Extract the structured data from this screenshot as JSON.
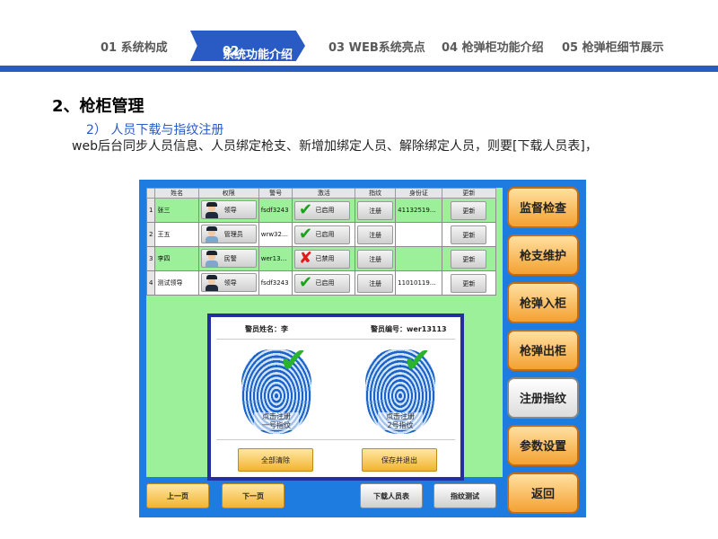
{
  "nav": {
    "items": [
      {
        "num": "01",
        "label": "系统构成"
      },
      {
        "num": "02",
        "label": "系统功能介绍"
      },
      {
        "num": "03",
        "label": "WEB系统亮点"
      },
      {
        "num": "04",
        "label": "枪弹柜功能介绍"
      },
      {
        "num": "05",
        "label": "枪弹柜细节展示"
      }
    ],
    "active_index": 1,
    "accent_color": "#2a5bc4"
  },
  "heading": "2、枪柜管理",
  "subheading": "2）  人员下载与指纹注册",
  "body_text": "web后台同步人员信息、人员绑定枪支、新增加绑定人员、解除绑定人员，则要[下载人员表]，",
  "app": {
    "columns": [
      "姓名",
      "权限",
      "警号",
      "激活",
      "指纹",
      "身份证",
      "更新"
    ],
    "rows": [
      {
        "idx": "1",
        "name": "张三",
        "role": "领导",
        "badge": "fsdf3243",
        "status": "已启用",
        "status_ok": true,
        "fp": "注册",
        "id": "41132519…",
        "update": "更新"
      },
      {
        "idx": "2",
        "name": "王五",
        "role": "管理员",
        "badge": "wrw32…",
        "status": "已启用",
        "status_ok": true,
        "fp": "注册",
        "id": "",
        "update": "更新"
      },
      {
        "idx": "3",
        "name": "李四",
        "role": "民警",
        "badge": "wer13…",
        "status": "已禁用",
        "status_ok": false,
        "fp": "注册",
        "id": "",
        "update": "更新"
      },
      {
        "idx": "4",
        "name": "测试领导",
        "role": "领导",
        "badge": "fsdf3243",
        "status": "已启用",
        "status_ok": true,
        "fp": "注册",
        "id": "11010119…",
        "update": "更新"
      }
    ],
    "popup": {
      "name_label": "警员姓名：李",
      "number_label": "警员编号：wer13113",
      "fp_left_label": "点击注册\n一号指纹",
      "fp_right_label": "点击注册\n2号指纹",
      "clear_button": "全部清除",
      "save_button": "保存并退出"
    },
    "bottom_buttons": {
      "prev": "上一页",
      "next": "下一页",
      "download": "下载人员表",
      "fp_test": "指纹测试"
    },
    "side_buttons": [
      "监督检查",
      "枪支维护",
      "枪弹入柜",
      "枪弹出柜",
      "注册指纹",
      "参数设置",
      "返回"
    ],
    "side_active_index": 4
  }
}
